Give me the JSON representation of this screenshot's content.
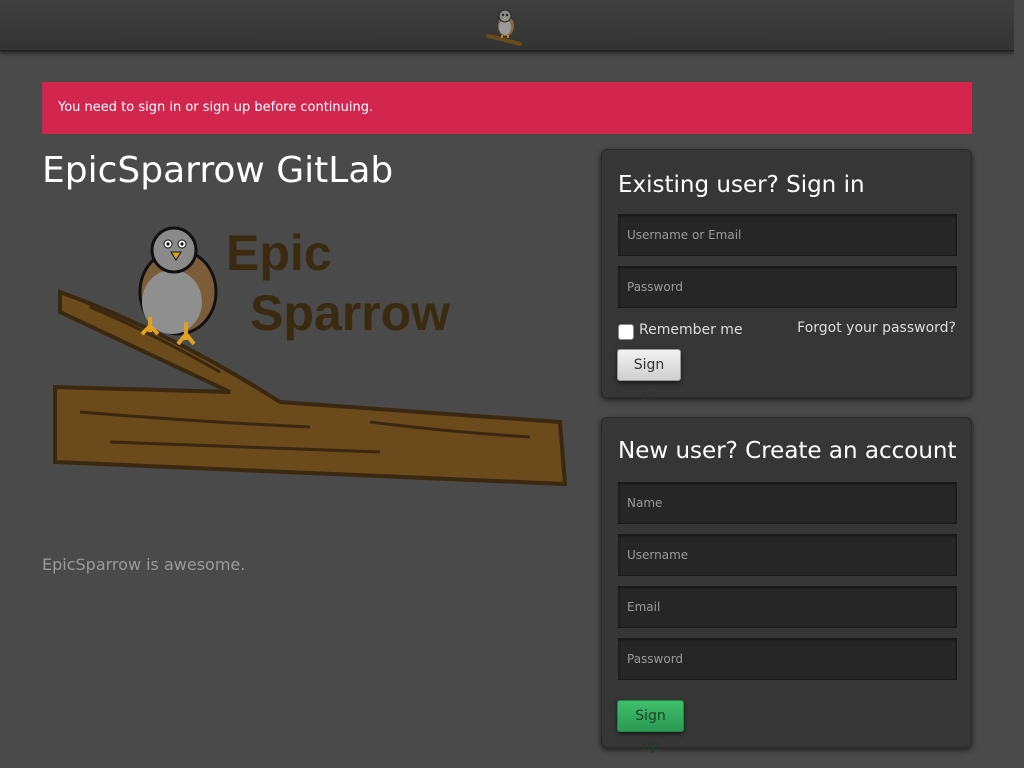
{
  "header": {
    "logo_icon": "sparrow-logo-icon"
  },
  "alert": {
    "message": "You need to sign in or sign up before continuing.",
    "color": "#d2264f"
  },
  "brand": {
    "title": "EpicSparrow GitLab",
    "logo_word1": "Epic",
    "logo_word2": "Sparrow",
    "description": "EpicSparrow is awesome."
  },
  "signin": {
    "heading": "Existing user? Sign in",
    "login_placeholder": "Username or Email",
    "password_placeholder": "Password",
    "remember_label": "Remember me",
    "forgot_link": "Forgot your password?",
    "submit_label": "Sign in"
  },
  "signup": {
    "heading": "New user? Create an account",
    "name_placeholder": "Name",
    "username_placeholder": "Username",
    "email_placeholder": "Email",
    "password_placeholder": "Password",
    "submit_label": "Sign up",
    "button_color": "#2b9a52"
  }
}
